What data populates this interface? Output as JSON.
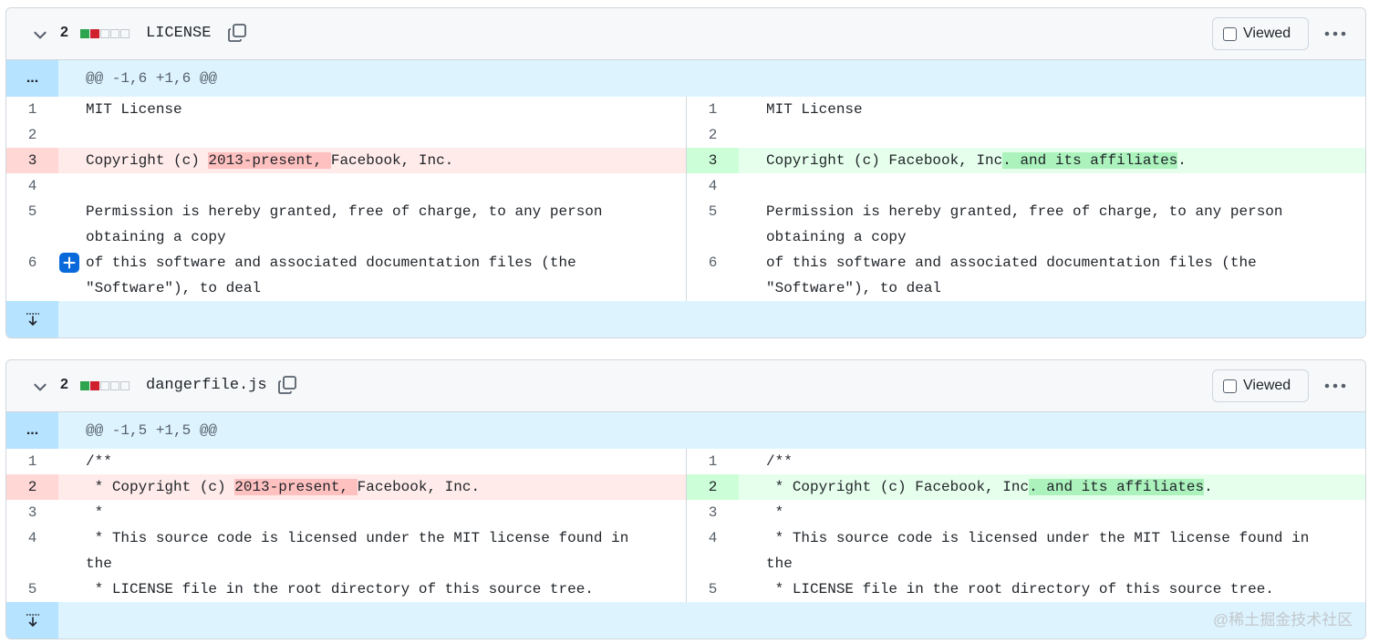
{
  "files": [
    {
      "count": "2",
      "name": "LICENSE",
      "viewed_label": "Viewed",
      "hunk_expand": "...",
      "hunk_header": "@@ -1,6 +1,6 @@",
      "left": [
        {
          "num": "1",
          "type": "ctx",
          "text": "MIT License"
        },
        {
          "num": "2",
          "type": "ctx",
          "text": ""
        },
        {
          "num": "3",
          "type": "del",
          "pre": "Copyright (c) ",
          "hl": "2013-present, ",
          "post": "Facebook, Inc."
        },
        {
          "num": "4",
          "type": "ctx",
          "text": ""
        },
        {
          "num": "5",
          "type": "ctx",
          "text": "Permission is hereby granted, free of charge, to any person obtaining a copy"
        },
        {
          "num": "6",
          "type": "ctx",
          "text": "of this software and associated documentation files (the \"Software\"), to deal"
        }
      ],
      "right": [
        {
          "num": "1",
          "type": "ctx",
          "text": "MIT License"
        },
        {
          "num": "2",
          "type": "ctx",
          "text": ""
        },
        {
          "num": "3",
          "type": "add",
          "pre": "Copyright (c) Facebook, Inc",
          "hl": ". and its affiliates",
          "post": "."
        },
        {
          "num": "4",
          "type": "ctx",
          "text": ""
        },
        {
          "num": "5",
          "type": "ctx",
          "text": "Permission is hereby granted, free of charge, to any person obtaining a copy"
        },
        {
          "num": "6",
          "type": "ctx",
          "text": "of this software and associated documentation files (the \"Software\"), to deal"
        }
      ]
    },
    {
      "count": "2",
      "name": "dangerfile.js",
      "viewed_label": "Viewed",
      "hunk_expand": "...",
      "hunk_header": "@@ -1,5 +1,5 @@",
      "left": [
        {
          "num": "1",
          "type": "ctx",
          "text": "/**"
        },
        {
          "num": "2",
          "type": "del",
          "pre": " * Copyright (c) ",
          "hl": "2013-present, ",
          "post": "Facebook, Inc."
        },
        {
          "num": "3",
          "type": "ctx",
          "text": " *"
        },
        {
          "num": "4",
          "type": "ctx",
          "text": " * This source code is licensed under the MIT license found in the"
        },
        {
          "num": "5",
          "type": "ctx",
          "text": " * LICENSE file in the root directory of this source tree."
        }
      ],
      "right": [
        {
          "num": "1",
          "type": "ctx",
          "text": "/**"
        },
        {
          "num": "2",
          "type": "add",
          "pre": " * Copyright (c) Facebook, Inc",
          "hl": ". and its affiliates",
          "post": "."
        },
        {
          "num": "3",
          "type": "ctx",
          "text": " *"
        },
        {
          "num": "4",
          "type": "ctx",
          "text": " * This source code is licensed under the MIT license found in the"
        },
        {
          "num": "5",
          "type": "ctx",
          "text": " * LICENSE file in the root directory of this source tree."
        }
      ]
    }
  ],
  "watermark": "@稀土掘金技术社区",
  "icons": {
    "collapse": "chevron-down-icon",
    "copy": "copy-icon",
    "more": "kebab-horizontal-icon",
    "expand_down": "fold-down-icon",
    "add_comment": "plus-icon"
  }
}
